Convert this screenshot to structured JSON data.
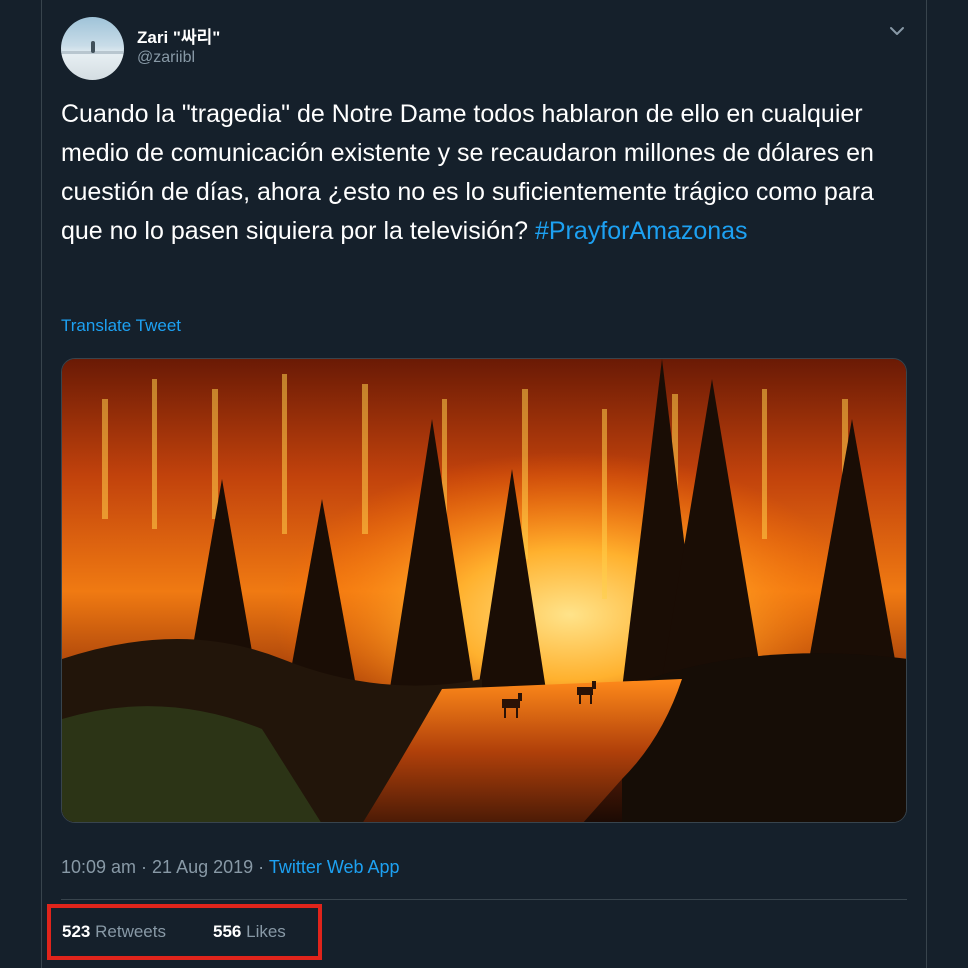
{
  "user": {
    "display_name": "Zari \"싸리\"",
    "handle": "@zariibl",
    "avatar_icon": "avatar-photo"
  },
  "tweet": {
    "text": "Cuando la \"tragedia\" de Notre Dame todos hablaron de ello en cualquier medio de comunicación existente y se recaudaron millones de dólares en cuestión de días, ahora ¿esto no es lo suficientemente trágico como para que no lo pasen siquiera por la televisión?",
    "hashtag": "#PrayforAmazonas",
    "translate_label": "Translate Tweet",
    "time_date": "10:09 am · 21 Aug 2019 · ",
    "source_app": "Twitter Web App"
  },
  "stats": {
    "retweets_count": "523",
    "retweets_label": "Retweets",
    "likes_count": "556",
    "likes_label": "Likes"
  },
  "colors": {
    "background": "#15202b",
    "link": "#1da1f2",
    "secondary_text": "#8899a6",
    "highlight_box": "#e0241b"
  }
}
